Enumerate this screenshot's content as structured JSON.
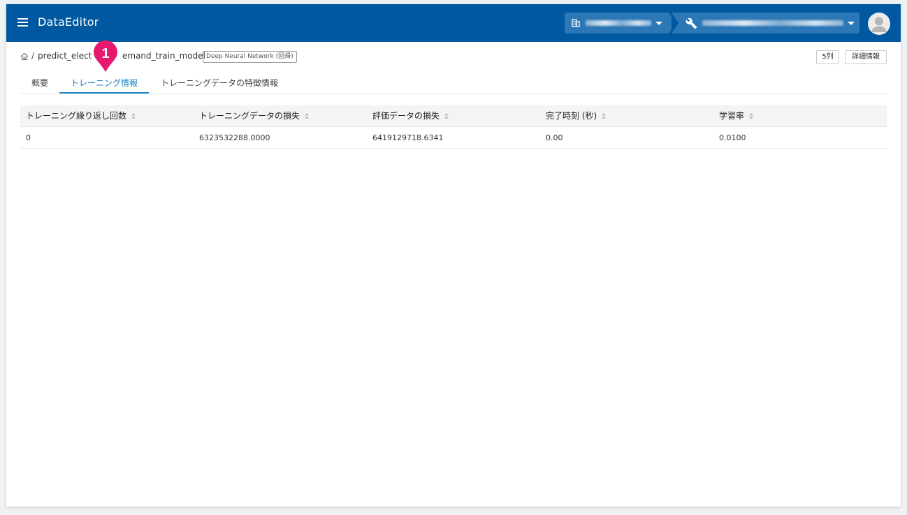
{
  "app": {
    "title": "DataEditor"
  },
  "header": {
    "workspace_icon": "building-icon",
    "project_icon": "wrench-icon",
    "avatar_icon": "user-avatar-icon"
  },
  "breadcrumb": {
    "home_icon": "home-icon",
    "separator": "/",
    "model_name": "predict_elect",
    "model_name_tail": "emand_train_model",
    "model_type": "Deep Neural Network (回帰)"
  },
  "actions": {
    "columns": "5列",
    "details": "詳細情報"
  },
  "tabs": [
    {
      "label": "概要",
      "active": false
    },
    {
      "label": "トレーニング情報",
      "active": true
    },
    {
      "label": "トレーニングデータの特徴情報",
      "active": false
    }
  ],
  "table": {
    "columns": [
      "トレーニング繰り返し回数",
      "トレーニングデータの損失",
      "評価データの損失",
      "完了時刻 (秒)",
      "学習率"
    ],
    "rows": [
      [
        "0",
        "6323532288.0000",
        "6419129718.6341",
        "0.00",
        "0.0100"
      ]
    ]
  },
  "callout": {
    "number": "1",
    "color": "#e6196e"
  },
  "colors": {
    "appbar": "#0058a0",
    "accent": "#1b84c2"
  }
}
